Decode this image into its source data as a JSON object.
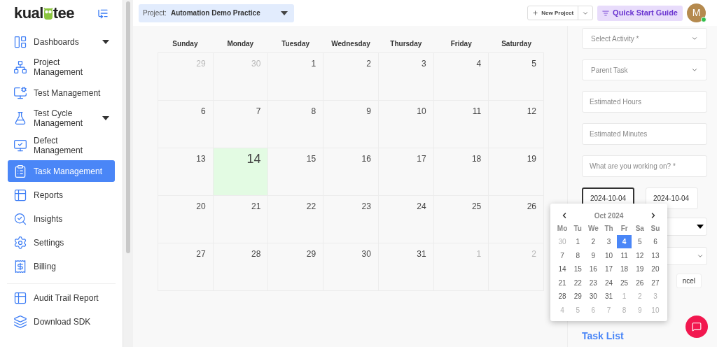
{
  "logo": {
    "left": "kual",
    "right": "tee"
  },
  "sidebar": {
    "items": [
      {
        "label": "Dashboards",
        "expandable": true,
        "selected": false
      },
      {
        "label": "Project Management",
        "expandable": false,
        "selected": false
      },
      {
        "label": "Test Management",
        "expandable": false,
        "selected": false
      },
      {
        "label": "Test Cycle Management",
        "expandable": true,
        "selected": false
      },
      {
        "label": "Defect Management",
        "expandable": false,
        "selected": false
      },
      {
        "label": "Task Management",
        "expandable": false,
        "selected": true
      },
      {
        "label": "Reports",
        "expandable": false,
        "selected": false
      },
      {
        "label": "Insights",
        "expandable": false,
        "selected": false
      },
      {
        "label": "Settings",
        "expandable": false,
        "selected": false
      },
      {
        "label": "Billing",
        "expandable": false,
        "selected": false
      }
    ],
    "footer_items": [
      {
        "label": "Audit Trail Report"
      },
      {
        "label": "Download SDK"
      }
    ]
  },
  "header": {
    "project_label": "Project:",
    "project_value": "Automation Demo Practice",
    "new_project": "New Project",
    "quick_start": "Quick Start Guide",
    "avatar": "M",
    "online": true
  },
  "calendar": {
    "weekdays": [
      "Sunday",
      "Monday",
      "Tuesday",
      "Wednesday",
      "Thursday",
      "Friday",
      "Saturday"
    ],
    "weeks": [
      [
        {
          "day": "29",
          "muted": true,
          "today": false
        },
        {
          "day": "30",
          "muted": true,
          "today": false
        },
        {
          "day": "1",
          "muted": false,
          "today": false
        },
        {
          "day": "2",
          "muted": false,
          "today": false
        },
        {
          "day": "3",
          "muted": false,
          "today": false
        },
        {
          "day": "4",
          "muted": false,
          "today": false
        },
        {
          "day": "5",
          "muted": false,
          "today": false
        }
      ],
      [
        {
          "day": "6",
          "muted": false,
          "today": false
        },
        {
          "day": "7",
          "muted": false,
          "today": false
        },
        {
          "day": "8",
          "muted": false,
          "today": false
        },
        {
          "day": "9",
          "muted": false,
          "today": false
        },
        {
          "day": "10",
          "muted": false,
          "today": false
        },
        {
          "day": "11",
          "muted": false,
          "today": false
        },
        {
          "day": "12",
          "muted": false,
          "today": false
        }
      ],
      [
        {
          "day": "13",
          "muted": false,
          "today": false
        },
        {
          "day": "14",
          "muted": false,
          "today": true
        },
        {
          "day": "15",
          "muted": false,
          "today": false
        },
        {
          "day": "16",
          "muted": false,
          "today": false
        },
        {
          "day": "17",
          "muted": false,
          "today": false
        },
        {
          "day": "18",
          "muted": false,
          "today": false
        },
        {
          "day": "19",
          "muted": false,
          "today": false
        }
      ],
      [
        {
          "day": "20",
          "muted": false,
          "today": false
        },
        {
          "day": "21",
          "muted": false,
          "today": false
        },
        {
          "day": "22",
          "muted": false,
          "today": false
        },
        {
          "day": "23",
          "muted": false,
          "today": false
        },
        {
          "day": "24",
          "muted": false,
          "today": false
        },
        {
          "day": "25",
          "muted": false,
          "today": false
        },
        {
          "day": "26",
          "muted": false,
          "today": false
        }
      ],
      [
        {
          "day": "27",
          "muted": false,
          "today": false
        },
        {
          "day": "28",
          "muted": false,
          "today": false
        },
        {
          "day": "29",
          "muted": false,
          "today": false
        },
        {
          "day": "30",
          "muted": false,
          "today": false
        },
        {
          "day": "31",
          "muted": false,
          "today": false
        },
        {
          "day": "1",
          "muted": true,
          "today": false
        },
        {
          "day": "2",
          "muted": true,
          "today": false
        }
      ]
    ]
  },
  "form": {
    "fields": [
      {
        "kind": "select",
        "placeholder": "Select Activity *"
      },
      {
        "kind": "select",
        "placeholder": "Parent Task"
      },
      {
        "kind": "input",
        "placeholder": "Estimated Hours"
      },
      {
        "kind": "input",
        "placeholder": "Estimated Minutes"
      },
      {
        "kind": "input",
        "placeholder": "What are you working on? *"
      }
    ],
    "dates": [
      {
        "value": "2024-10-04",
        "focused": true
      },
      {
        "value": "2024-10-04",
        "focused": false
      }
    ],
    "cancel": "ncel",
    "task_list": "Task List"
  },
  "datepicker": {
    "month": "Oct 2024",
    "weekdays": [
      "Mo",
      "Tu",
      "We",
      "Th",
      "Fr",
      "Sa",
      "Su"
    ],
    "weeks": [
      [
        {
          "day": "30",
          "muted": true,
          "selected": false
        },
        {
          "day": "1",
          "muted": false,
          "selected": false
        },
        {
          "day": "2",
          "muted": false,
          "selected": false
        },
        {
          "day": "3",
          "muted": false,
          "selected": false
        },
        {
          "day": "4",
          "muted": false,
          "selected": true
        },
        {
          "day": "5",
          "muted": false,
          "selected": false
        },
        {
          "day": "6",
          "muted": false,
          "selected": false
        }
      ],
      [
        {
          "day": "7",
          "muted": false,
          "selected": false
        },
        {
          "day": "8",
          "muted": false,
          "selected": false
        },
        {
          "day": "9",
          "muted": false,
          "selected": false
        },
        {
          "day": "10",
          "muted": false,
          "selected": false
        },
        {
          "day": "11",
          "muted": false,
          "selected": false
        },
        {
          "day": "12",
          "muted": false,
          "selected": false
        },
        {
          "day": "13",
          "muted": false,
          "selected": false
        }
      ],
      [
        {
          "day": "14",
          "muted": false,
          "selected": false
        },
        {
          "day": "15",
          "muted": false,
          "selected": false
        },
        {
          "day": "16",
          "muted": false,
          "selected": false
        },
        {
          "day": "17",
          "muted": false,
          "selected": false
        },
        {
          "day": "18",
          "muted": false,
          "selected": false
        },
        {
          "day": "19",
          "muted": false,
          "selected": false
        },
        {
          "day": "20",
          "muted": false,
          "selected": false
        }
      ],
      [
        {
          "day": "21",
          "muted": false,
          "selected": false
        },
        {
          "day": "22",
          "muted": false,
          "selected": false
        },
        {
          "day": "23",
          "muted": false,
          "selected": false
        },
        {
          "day": "24",
          "muted": false,
          "selected": false
        },
        {
          "day": "25",
          "muted": false,
          "selected": false
        },
        {
          "day": "26",
          "muted": false,
          "selected": false
        },
        {
          "day": "27",
          "muted": false,
          "selected": false
        }
      ],
      [
        {
          "day": "28",
          "muted": false,
          "selected": false
        },
        {
          "day": "29",
          "muted": false,
          "selected": false
        },
        {
          "day": "30",
          "muted": false,
          "selected": false
        },
        {
          "day": "31",
          "muted": false,
          "selected": false
        },
        {
          "day": "1",
          "muted": true,
          "selected": false
        },
        {
          "day": "2",
          "muted": true,
          "selected": false
        },
        {
          "day": "3",
          "muted": true,
          "selected": false
        }
      ],
      [
        {
          "day": "4",
          "muted": true,
          "selected": false
        },
        {
          "day": "5",
          "muted": true,
          "selected": false
        },
        {
          "day": "6",
          "muted": true,
          "selected": false
        },
        {
          "day": "7",
          "muted": true,
          "selected": false
        },
        {
          "day": "8",
          "muted": true,
          "selected": false
        },
        {
          "day": "9",
          "muted": true,
          "selected": false
        },
        {
          "day": "10",
          "muted": true,
          "selected": false
        }
      ]
    ]
  }
}
